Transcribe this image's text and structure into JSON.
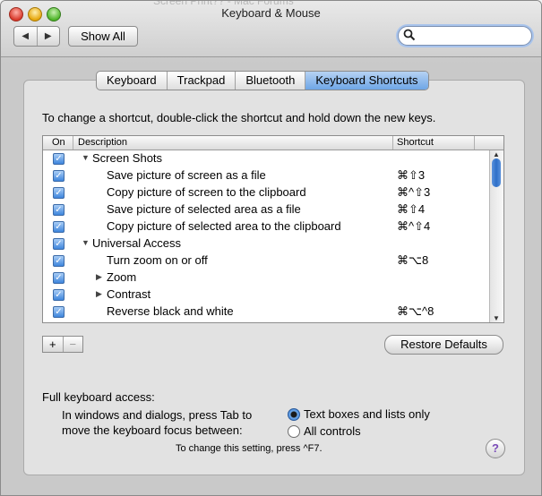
{
  "window": {
    "title": "Keyboard & Mouse",
    "background_title": "Screen Print?? - Mac Forums"
  },
  "toolbar": {
    "back_glyph": "◀",
    "forward_glyph": "▶",
    "show_all_label": "Show All",
    "search_value": ""
  },
  "tabs": [
    {
      "label": "Keyboard",
      "active": false
    },
    {
      "label": "Trackpad",
      "active": false
    },
    {
      "label": "Bluetooth",
      "active": false
    },
    {
      "label": "Keyboard Shortcuts",
      "active": true
    }
  ],
  "instruction": "To change a shortcut, double-click the shortcut and hold down the new keys.",
  "table": {
    "headers": {
      "on": "On",
      "description": "Description",
      "shortcut": "Shortcut"
    },
    "rows": [
      {
        "checked": true,
        "level": 0,
        "expander": "▼",
        "description": "Screen Shots",
        "shortcut": ""
      },
      {
        "checked": true,
        "level": 1,
        "expander": "",
        "description": "Save picture of screen as a file",
        "shortcut": "⌘⇧3"
      },
      {
        "checked": true,
        "level": 1,
        "expander": "",
        "description": "Copy picture of screen to the clipboard",
        "shortcut": "⌘^⇧3"
      },
      {
        "checked": true,
        "level": 1,
        "expander": "",
        "description": "Save picture of selected area as a file",
        "shortcut": "⌘⇧4"
      },
      {
        "checked": true,
        "level": 1,
        "expander": "",
        "description": "Copy picture of selected area to the clipboard",
        "shortcut": "⌘^⇧4"
      },
      {
        "checked": true,
        "level": 0,
        "expander": "▼",
        "description": "Universal Access",
        "shortcut": ""
      },
      {
        "checked": true,
        "level": 1,
        "expander": "",
        "description": "Turn zoom on or off",
        "shortcut": "⌘⌥8"
      },
      {
        "checked": true,
        "level": 1,
        "expander": "▶",
        "description": "Zoom",
        "shortcut": ""
      },
      {
        "checked": true,
        "level": 1,
        "expander": "▶",
        "description": "Contrast",
        "shortcut": ""
      },
      {
        "checked": true,
        "level": 1,
        "expander": "",
        "description": "Reverse black and white",
        "shortcut": "⌘⌥^8"
      }
    ]
  },
  "buttons": {
    "add_label": "+",
    "remove_label": "−",
    "restore_defaults_label": "Restore Defaults",
    "help_label": "?"
  },
  "keyboard_access": {
    "title": "Full keyboard access:",
    "description_line1": "In windows and dialogs, press Tab to",
    "description_line2": "move the keyboard focus between:",
    "options": [
      {
        "label": "Text boxes and lists only",
        "selected": true
      },
      {
        "label": "All controls",
        "selected": false
      }
    ],
    "hint": "To change this setting, press ^F7."
  },
  "icons": {
    "search": "search-icon",
    "close": "close-window-icon",
    "minimize": "minimize-window-icon",
    "zoom": "zoom-window-icon"
  },
  "colors": {
    "accent": "#3e85dc",
    "tab_active": "#8ab8ec",
    "help_icon": "#7a4bb8"
  }
}
